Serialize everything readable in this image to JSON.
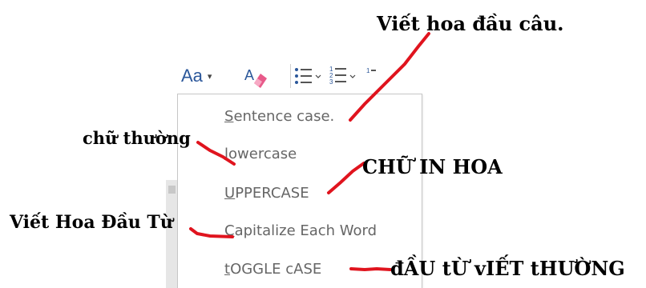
{
  "toolbar": {
    "change_case_label": "Aa",
    "change_case_caret": "▾",
    "icons": [
      "clear-formatting-icon",
      "bullets-icon",
      "numbering-icon",
      "multilevel-list-icon"
    ]
  },
  "menu": {
    "items": [
      {
        "accel": "S",
        "rest": "entence case."
      },
      {
        "accel": "l",
        "rest": "owercase"
      },
      {
        "accel": "U",
        "rest": "PPERCASE"
      },
      {
        "accel": "C",
        "rest": "apitalize Each Word"
      },
      {
        "accel": "t",
        "rest": "OGGLE cASE"
      }
    ]
  },
  "annotations": {
    "sentence_case": "Viết hoa đầu câu.",
    "lowercase": "chữ thường",
    "uppercase": "CHỮ IN HOA",
    "capitalize": "Viết Hoa Đầu Từ",
    "toggle_case": "đẦU tỪ vIẾT tHƯỜNG"
  },
  "colors": {
    "accent_blue": "#2b579a",
    "menu_text": "#666666",
    "annotation_line": "#e0141e"
  }
}
